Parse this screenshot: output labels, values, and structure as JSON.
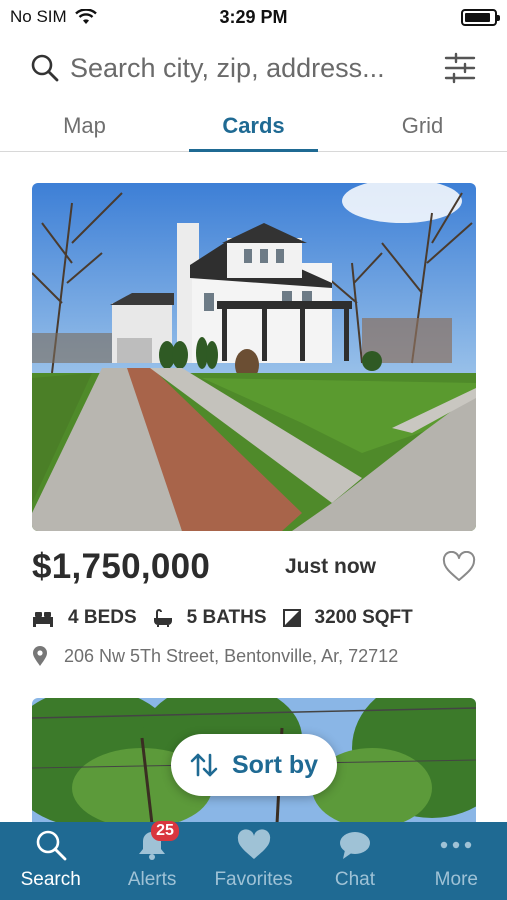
{
  "status_bar": {
    "carrier": "No SIM",
    "time": "3:29 PM",
    "battery_level": 0.9
  },
  "search": {
    "placeholder": "Search city, zip, address...",
    "icon": "search-icon",
    "filter_icon": "sliders-icon"
  },
  "tabs": [
    {
      "label": "Map",
      "active": false
    },
    {
      "label": "Cards",
      "active": true
    },
    {
      "label": "Grid",
      "active": false
    }
  ],
  "listing": {
    "price": "$1,750,000",
    "posted": "Just now",
    "beds": "4 BEDS",
    "baths": "5 BATHS",
    "sqft": "3200 SQFT",
    "address": "206 Nw 5Th Street, Bentonville, Ar, 72712"
  },
  "sort": {
    "label": "Sort by"
  },
  "bottom_nav": [
    {
      "label": "Search",
      "icon": "search-icon",
      "active": true
    },
    {
      "label": "Alerts",
      "icon": "bell-icon",
      "badge": "25"
    },
    {
      "label": "Favorites",
      "icon": "heart-icon"
    },
    {
      "label": "Chat",
      "icon": "chat-bubble-icon"
    },
    {
      "label": "More",
      "icon": "more-dots-icon"
    }
  ],
  "colors": {
    "accent": "#1f6a93",
    "nav_inactive": "#9fc2d6",
    "badge": "#d9363e"
  }
}
